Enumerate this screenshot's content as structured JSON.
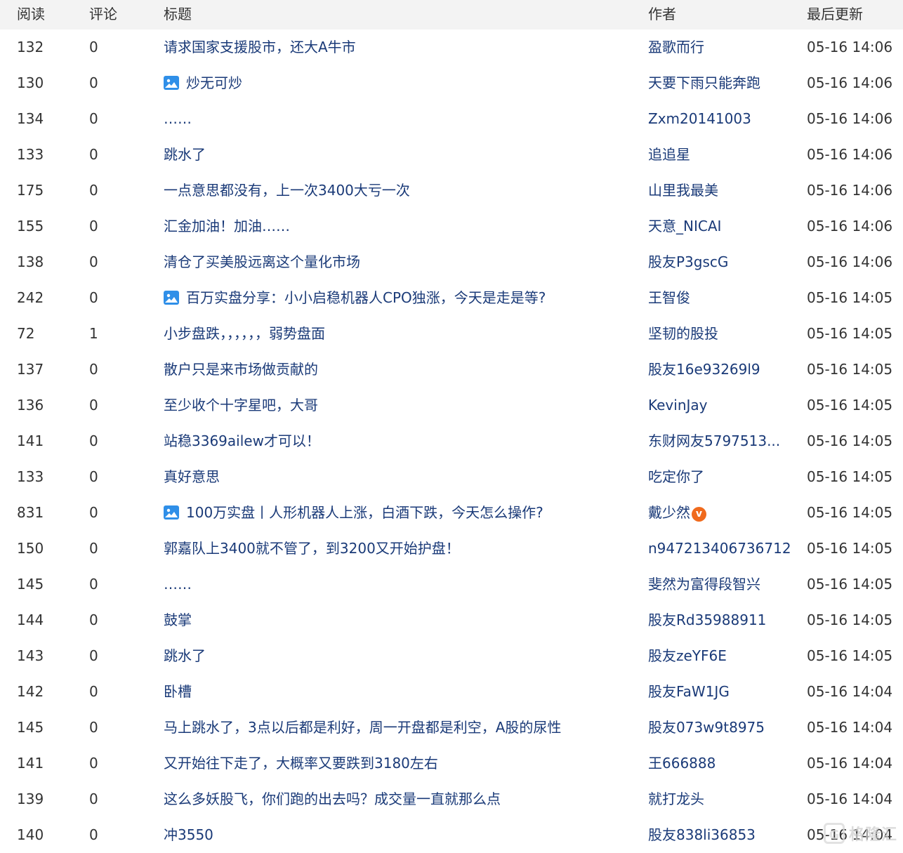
{
  "header": {
    "read": "阅读",
    "comment": "评论",
    "title": "标题",
    "author": "作者",
    "updated": "最后更新"
  },
  "rows": [
    {
      "read": "132",
      "comment": "0",
      "title": "请求国家支援股市，还大A牛市",
      "author": "盈歌而行",
      "time": "05-16 14:06",
      "has_image": false
    },
    {
      "read": "130",
      "comment": "0",
      "title": "炒无可炒",
      "author": "天要下雨只能奔跑",
      "time": "05-16 14:06",
      "has_image": true
    },
    {
      "read": "134",
      "comment": "0",
      "title": "……",
      "author": "Zxm20141003",
      "time": "05-16 14:06",
      "has_image": false
    },
    {
      "read": "133",
      "comment": "0",
      "title": "跳水了",
      "author": "追追星",
      "time": "05-16 14:06",
      "has_image": false
    },
    {
      "read": "175",
      "comment": "0",
      "title": "一点意思都没有，上一次3400大亏一次",
      "author": "山里我最美",
      "time": "05-16 14:06",
      "has_image": false
    },
    {
      "read": "155",
      "comment": "0",
      "title": "汇金加油！加油……",
      "author": "天意_NICAI",
      "time": "05-16 14:06",
      "has_image": false
    },
    {
      "read": "138",
      "comment": "0",
      "title": "清仓了买美股远离这个量化市场",
      "author": "股友P3gscG",
      "time": "05-16 14:06",
      "has_image": false
    },
    {
      "read": "242",
      "comment": "0",
      "title": "百万实盘分享：小小启稳机器人CPO独涨，今天是走是等?",
      "author": "王智俊",
      "time": "05-16 14:05",
      "has_image": true
    },
    {
      "read": "72",
      "comment": "1",
      "title": "小步盘跌，，，，，，弱势盘面",
      "author": "坚韧的股投",
      "time": "05-16 14:05",
      "has_image": false
    },
    {
      "read": "137",
      "comment": "0",
      "title": "散户只是来市场做贡献的",
      "author": "股友16e93269l9",
      "time": "05-16 14:05",
      "has_image": false
    },
    {
      "read": "136",
      "comment": "0",
      "title": "至少收个十字星吧，大哥",
      "author": "KevinJay",
      "time": "05-16 14:05",
      "has_image": false
    },
    {
      "read": "141",
      "comment": "0",
      "title": "站稳3369ailew才可以！",
      "author": "东财网友5797513...",
      "time": "05-16 14:05",
      "has_image": false
    },
    {
      "read": "133",
      "comment": "0",
      "title": "真好意思",
      "author": "吃定你了",
      "time": "05-16 14:05",
      "has_image": false
    },
    {
      "read": "831",
      "comment": "0",
      "title": "100万实盘丨人形机器人上涨，白酒下跌，今天怎么操作?",
      "author": "戴少然",
      "time": "05-16 14:05",
      "has_image": true,
      "verified": true
    },
    {
      "read": "150",
      "comment": "0",
      "title": "郭嘉队上3400就不管了，到3200又开始护盘！",
      "author": "n947213406736712",
      "time": "05-16 14:05",
      "has_image": false
    },
    {
      "read": "145",
      "comment": "0",
      "title": "……",
      "author": "斐然为富得段智兴",
      "time": "05-16 14:05",
      "has_image": false
    },
    {
      "read": "144",
      "comment": "0",
      "title": "鼓掌",
      "author": "股友Rd35988911",
      "time": "05-16 14:05",
      "has_image": false
    },
    {
      "read": "143",
      "comment": "0",
      "title": "跳水了",
      "author": "股友zeYF6E",
      "time": "05-16 14:05",
      "has_image": false
    },
    {
      "read": "142",
      "comment": "0",
      "title": "卧槽",
      "author": "股友FaW1JG",
      "time": "05-16 14:04",
      "has_image": false
    },
    {
      "read": "145",
      "comment": "0",
      "title": "马上跳水了，3点以后都是利好，周一开盘都是利空，A股的尿性",
      "author": "股友073w9t8975",
      "time": "05-16 14:04",
      "has_image": false
    },
    {
      "read": "141",
      "comment": "0",
      "title": "又开始往下走了，大概率又要跌到3180左右",
      "author": "王666888",
      "time": "05-16 14:04",
      "has_image": false
    },
    {
      "read": "139",
      "comment": "0",
      "title": "这么多妖股飞，你们跑的出去吗？成交量一直就那么点",
      "author": "就打龙头",
      "time": "05-16 14:04",
      "has_image": false
    },
    {
      "read": "140",
      "comment": "0",
      "title": "冲3550",
      "author": "股友838li36853",
      "time": "05-16 14:04",
      "has_image": false
    }
  ],
  "watermark": {
    "text": "格隆汇",
    "logo": "G"
  },
  "icons": {
    "image_icon": "picture-icon",
    "verified_badge": "verified-v-icon"
  },
  "colors": {
    "link": "#1a3a78",
    "header_bg": "#f3f3f3",
    "image_icon": "#2f8fe8",
    "badge": "#f06a1d"
  }
}
